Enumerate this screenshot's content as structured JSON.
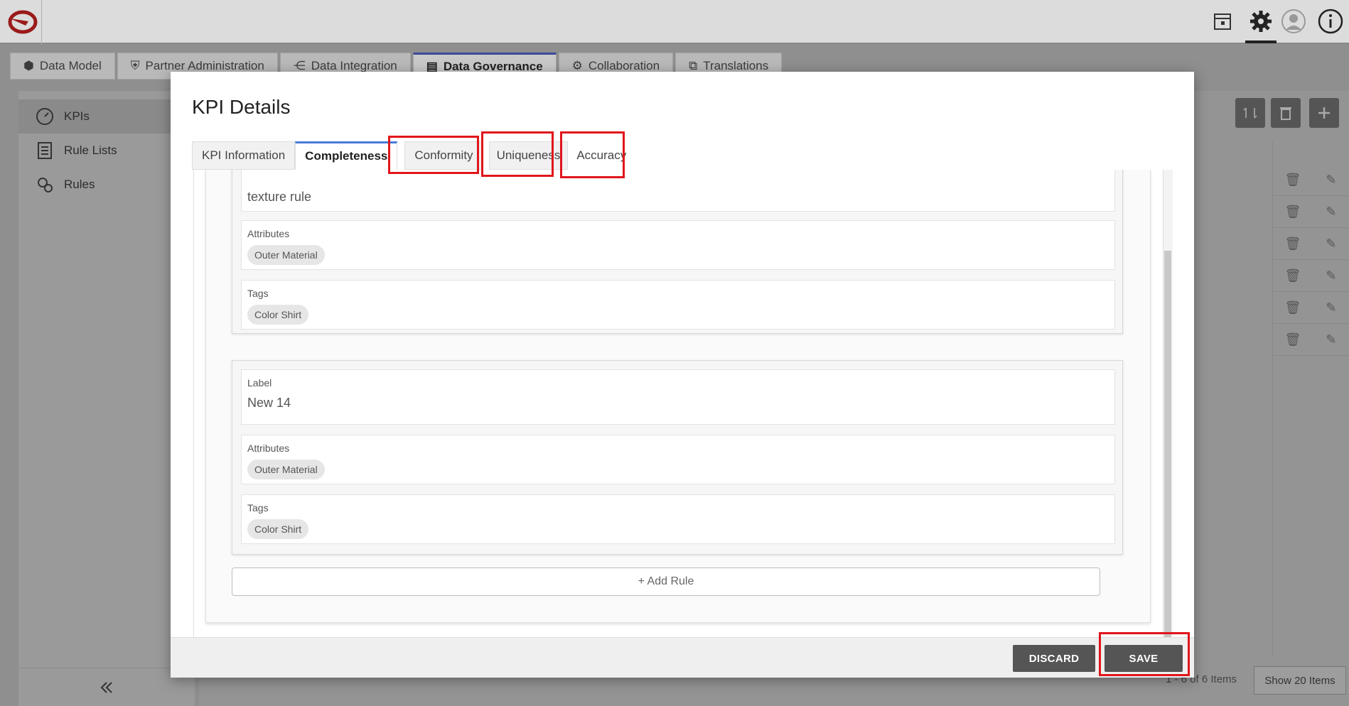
{
  "app_tabs": [
    {
      "label": "Data Model",
      "icon": "cubes-icon"
    },
    {
      "label": "Partner Administration",
      "icon": "shield-icon"
    },
    {
      "label": "Data Integration",
      "icon": "share-nodes-icon"
    },
    {
      "label": "Data Governance",
      "icon": "document-icon"
    },
    {
      "label": "Collaboration",
      "icon": "gears-icon"
    },
    {
      "label": "Translations",
      "icon": "translate-icon"
    }
  ],
  "sidebar": {
    "items": [
      {
        "label": "KPIs",
        "icon": "gauge-icon"
      },
      {
        "label": "Rule Lists",
        "icon": "list-icon"
      },
      {
        "label": "Rules",
        "icon": "cog-group-icon"
      }
    ]
  },
  "pager": {
    "summary": "1 - 6 of 6 Items",
    "page_size": "Show 20 Items"
  },
  "modal": {
    "title": "KPI Details",
    "tabs": [
      "KPI Information",
      "Completeness",
      "Conformity",
      "Uniqueness",
      "Accuracy"
    ],
    "active_tab": "Completeness",
    "rules": [
      {
        "label_value": "texture rule",
        "attributes_label": "Attributes",
        "attribute_chip": "Outer Material",
        "tags_label": "Tags",
        "tag_chip": "Color Shirt"
      },
      {
        "label_label": "Label",
        "label_value": "New 14",
        "attributes_label": "Attributes",
        "attribute_chip": "Outer Material",
        "tags_label": "Tags",
        "tag_chip": "Color Shirt"
      }
    ],
    "add_rule": "+ Add Rule",
    "discard": "DISCARD",
    "save": "SAVE"
  },
  "colors": {
    "highlight": "#e0161b",
    "active_tab_accent": "#4a7bd8",
    "button_dark": "#555555"
  }
}
